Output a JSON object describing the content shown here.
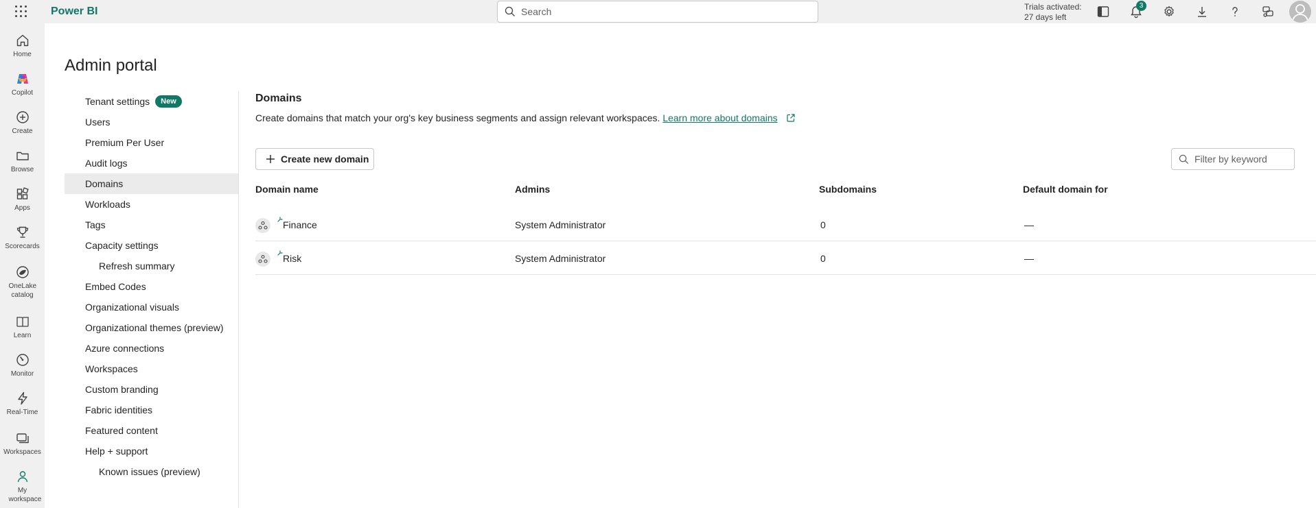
{
  "app": {
    "title": "Power BI"
  },
  "search": {
    "placeholder": "Search"
  },
  "trial": {
    "line1": "Trials activated:",
    "line2": "27 days left"
  },
  "notifications": {
    "count": "3"
  },
  "leftnav": [
    {
      "label": "Home",
      "icon": "home-icon"
    },
    {
      "label": "Copilot",
      "icon": "copilot-icon"
    },
    {
      "label": "Create",
      "icon": "create-icon"
    },
    {
      "label": "Browse",
      "icon": "folder-icon"
    },
    {
      "label": "Apps",
      "icon": "apps-icon"
    },
    {
      "label": "Scorecards",
      "icon": "trophy-icon"
    },
    {
      "label": "OneLake catalog",
      "icon": "onelake-icon"
    },
    {
      "label": "Learn",
      "icon": "book-icon"
    },
    {
      "label": "Monitor",
      "icon": "monitor-icon"
    },
    {
      "label": "Real-Time",
      "icon": "lightning-icon"
    },
    {
      "label": "Workspaces",
      "icon": "workspaces-icon"
    },
    {
      "label": "My workspace",
      "icon": "person-icon"
    }
  ],
  "page": {
    "title": "Admin portal"
  },
  "menu": {
    "items": [
      {
        "label": "Tenant settings",
        "badge": "New"
      },
      {
        "label": "Users"
      },
      {
        "label": "Premium Per User"
      },
      {
        "label": "Audit logs"
      },
      {
        "label": "Domains",
        "active": true
      },
      {
        "label": "Workloads"
      },
      {
        "label": "Tags"
      },
      {
        "label": "Capacity settings"
      },
      {
        "label": "Refresh summary",
        "sub": true
      },
      {
        "label": "Embed Codes"
      },
      {
        "label": "Organizational visuals"
      },
      {
        "label": "Organizational themes (preview)"
      },
      {
        "label": "Azure connections"
      },
      {
        "label": "Workspaces"
      },
      {
        "label": "Custom branding"
      },
      {
        "label": "Fabric identities"
      },
      {
        "label": "Featured content"
      },
      {
        "label": "Help + support"
      },
      {
        "label": "Known issues (preview)",
        "sub": true
      }
    ]
  },
  "domains": {
    "title": "Domains",
    "description": "Create domains that match your org's key business segments and assign relevant workspaces.",
    "learn_link": "Learn more about domains",
    "create_button": "Create new domain",
    "filter_placeholder": "Filter by keyword",
    "columns": {
      "name": "Domain name",
      "admins": "Admins",
      "subdomains": "Subdomains",
      "default_for": "Default domain for"
    },
    "rows": [
      {
        "name": "Finance",
        "admins": "System Administrator",
        "subdomains": "0",
        "default_for": "—"
      },
      {
        "name": "Risk",
        "admins": "System Administrator",
        "subdomains": "0",
        "default_for": "—"
      }
    ]
  },
  "colors": {
    "brand": "#117865",
    "chrome": "#f0f0f0",
    "active_menu": "#ebebeb"
  }
}
